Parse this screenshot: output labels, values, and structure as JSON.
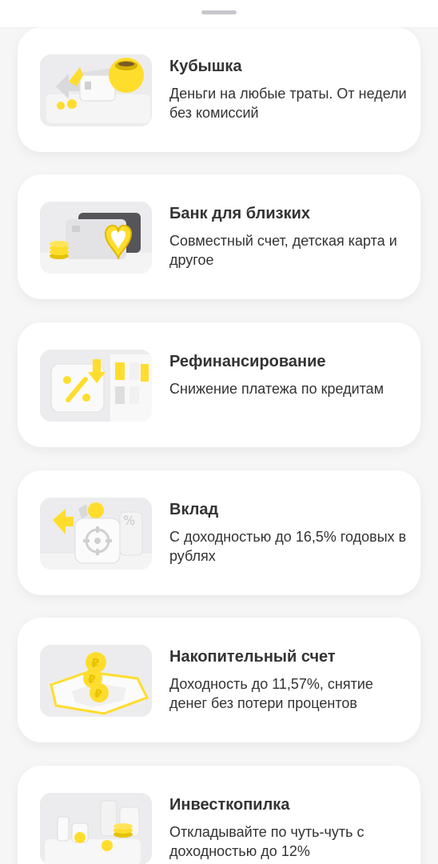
{
  "colors": {
    "accent": "#ffdd2d",
    "background": "#f6f6f7",
    "card": "#ffffff",
    "text": "#333333"
  },
  "products": [
    {
      "icon": "piggy-bank-card-icon",
      "title": "Кубышка",
      "description": "Деньги на любые траты. От недели без комиссий"
    },
    {
      "icon": "cards-heart-icon",
      "title": "Банк для близких",
      "description": "Совместный счет, детская карта и другое"
    },
    {
      "icon": "percent-refinance-icon",
      "title": "Рефинансирование",
      "description": "Снижение платежа по кредитам"
    },
    {
      "icon": "safe-deposit-icon",
      "title": "Вклад",
      "description": "С доходностью до 16,5% годовых в рублях"
    },
    {
      "icon": "coins-savings-icon",
      "title": "Накопительный счет",
      "description": "Доходность до 11,57%, снятие денег без потери процентов"
    },
    {
      "icon": "invest-piggy-icon",
      "title": "Инвесткопилка",
      "description": "Откладывайте по чуть-чуть с доходностью до 12%"
    }
  ]
}
